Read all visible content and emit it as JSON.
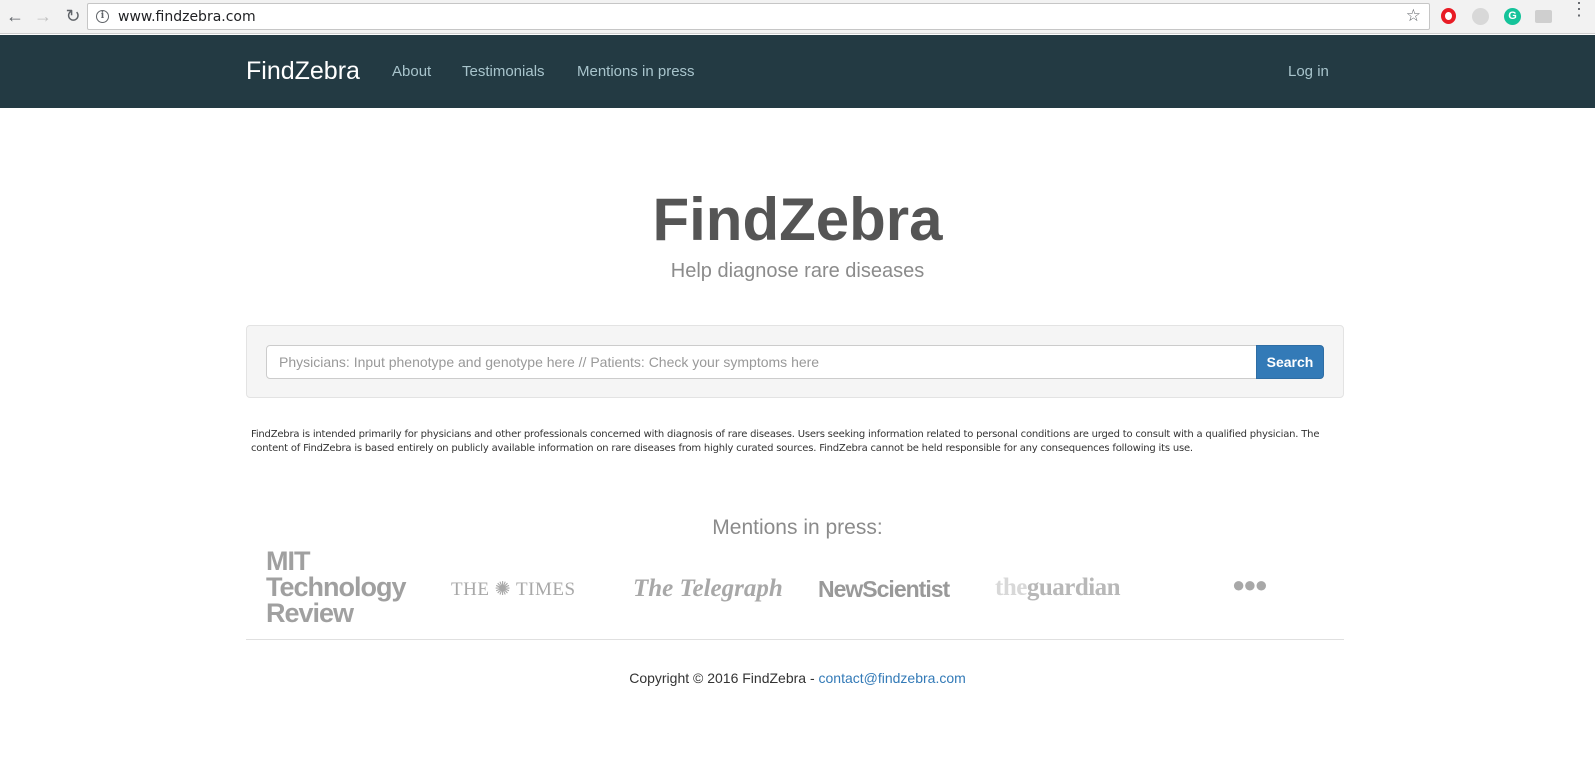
{
  "browser": {
    "url": "www.findzebra.com",
    "back_icon": "←",
    "forward_icon": "→",
    "reload_icon": "↻",
    "star_icon": "☆",
    "info_icon": "i",
    "grammarly_icon": "G",
    "menu_icon": "⋮"
  },
  "navbar": {
    "brand": "FindZebra",
    "links": [
      "About",
      "Testimonials",
      "Mentions in press"
    ],
    "login": "Log in"
  },
  "hero": {
    "title": "FindZebra",
    "subtitle": "Help diagnose rare diseases"
  },
  "search": {
    "placeholder": "Physicians: Input phenotype and genotype here // Patients: Check your symptoms here",
    "button_label": "Search"
  },
  "disclaimer": "FindZebra is intended primarily for physicians and other professionals concerned with diagnosis of rare diseases. Users seeking information related to personal conditions are urged to consult with a qualified physician. The content of FindZebra is based entirely on publicly available information on rare diseases from highly curated sources. FindZebra cannot be held responsible for any consequences following its use.",
  "press": {
    "heading": "Mentions in press:",
    "logos": {
      "mit_line1": "MIT",
      "mit_line2": "Technology",
      "mit_line3": "Review",
      "times": "THE ✺ TIMES",
      "telegraph": "The Telegraph",
      "newscientist": "NewScientist",
      "guardian_the": "the",
      "guardian_main": "guardian",
      "more": "●●●"
    }
  },
  "footer": {
    "copyright": "Copyright © 2016 FindZebra - ",
    "email": "contact@findzebra.com"
  },
  "colors": {
    "navbar_bg": "#233a43",
    "nav_link": "#a8c4cc",
    "primary": "#337ab7"
  }
}
